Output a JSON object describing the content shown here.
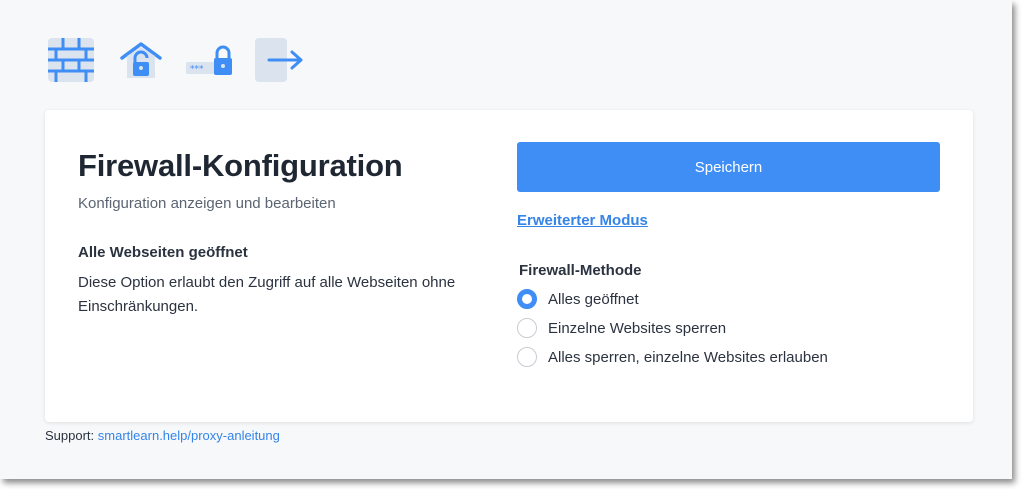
{
  "toolbar": {
    "icons": [
      "firewall-icon",
      "home-lock-icon",
      "password-lock-icon",
      "exit-icon"
    ]
  },
  "card": {
    "title": "Firewall-Konfiguration",
    "subtitle": "Konfiguration anzeigen und bearbeiten",
    "option_heading": "Alle Webseiten geöffnet",
    "option_description": "Diese Option erlaubt den Zugriff auf alle Webseiten ohne Einschränkungen.",
    "save_label": "Speichern",
    "advanced_link": "Erweiterter Modus",
    "method_label": "Firewall-Methode",
    "methods": [
      {
        "label": "Alles geöffnet",
        "selected": true
      },
      {
        "label": "Einzelne Websites sperren",
        "selected": false
      },
      {
        "label": "Alles sperren, einzelne Websites erlauben",
        "selected": false
      }
    ]
  },
  "support": {
    "label": "Support:",
    "link": "smartlearn.help/proxy-anleitung"
  },
  "colors": {
    "accent": "#3f8ef5",
    "link": "#3584e8",
    "icon_bg": "#dbe3ef"
  }
}
